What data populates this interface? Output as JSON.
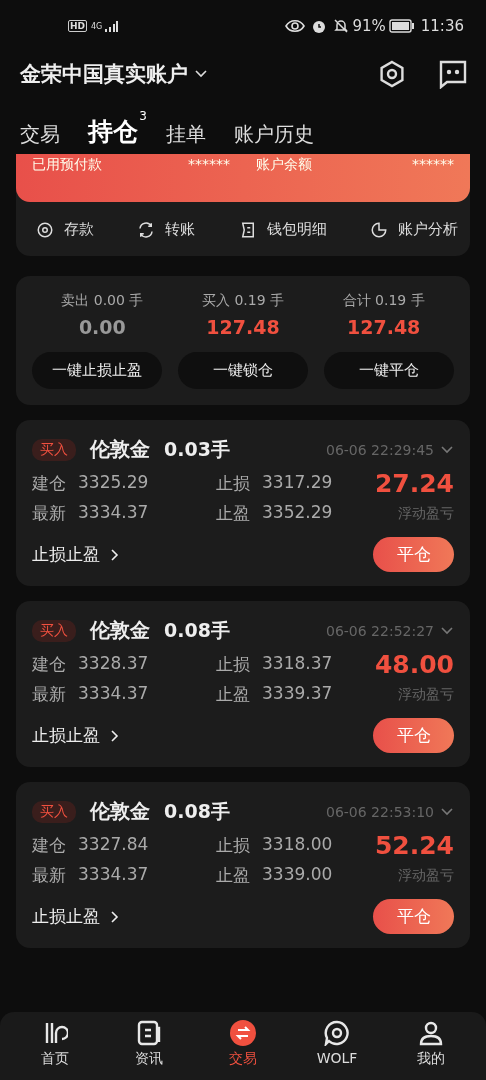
{
  "status_bar": {
    "left": [
      "HD",
      "4G"
    ],
    "battery": "91%",
    "time": "11:36"
  },
  "header": {
    "title": "金荣中国真实账户"
  },
  "tabs": [
    {
      "label": "交易",
      "selected": false
    },
    {
      "label": "持仓",
      "selected": true,
      "count": "3"
    },
    {
      "label": "挂单",
      "selected": false
    },
    {
      "label": "账户历史",
      "selected": false
    }
  ],
  "account_card": {
    "items": [
      {
        "label": "已用预付款",
        "value": "******"
      },
      {
        "label": "账户余额",
        "value": "******"
      }
    ],
    "actions": [
      {
        "label": "存款",
        "kind": "deposit"
      },
      {
        "label": "转账",
        "kind": "transfer"
      },
      {
        "label": "钱包明细",
        "kind": "wallet"
      },
      {
        "label": "账户分析",
        "kind": "analysis"
      }
    ]
  },
  "summary": {
    "columns": [
      {
        "label": "卖出 0.00 手",
        "value": "0.00",
        "positive": false
      },
      {
        "label": "买入 0.19 手",
        "value": "127.48",
        "positive": true
      },
      {
        "label": "合计 0.19 手",
        "value": "127.48",
        "positive": true
      }
    ],
    "buttons": [
      "一键止损止盈",
      "一键锁仓",
      "一键平仓"
    ]
  },
  "positions": [
    {
      "side": "买入",
      "symbol": "伦敦金",
      "lots": "0.03手",
      "time": "06-06 22:29:45",
      "open_label": "建仓",
      "open": "3325.29",
      "sl_label": "止损",
      "sl": "3317.29",
      "last_label": "最新",
      "last": "3334.37",
      "tp_label": "止盈",
      "tp": "3352.29",
      "profit": "27.24",
      "profit_label": "浮动盈亏",
      "link": "止损止盈",
      "close": "平仓"
    },
    {
      "side": "买入",
      "symbol": "伦敦金",
      "lots": "0.08手",
      "time": "06-06 22:52:27",
      "open_label": "建仓",
      "open": "3328.37",
      "sl_label": "止损",
      "sl": "3318.37",
      "last_label": "最新",
      "last": "3334.37",
      "tp_label": "止盈",
      "tp": "3339.37",
      "profit": "48.00",
      "profit_label": "浮动盈亏",
      "link": "止损止盈",
      "close": "平仓"
    },
    {
      "side": "买入",
      "symbol": "伦敦金",
      "lots": "0.08手",
      "time": "06-06 22:53:10",
      "open_label": "建仓",
      "open": "3327.84",
      "sl_label": "止损",
      "sl": "3318.00",
      "last_label": "最新",
      "last": "3334.37",
      "tp_label": "止盈",
      "tp": "3339.00",
      "profit": "52.24",
      "profit_label": "浮动盈亏",
      "link": "止损止盈",
      "close": "平仓"
    }
  ],
  "bottom_nav": [
    {
      "label": "首页",
      "kind": "home",
      "selected": false
    },
    {
      "label": "资讯",
      "kind": "news",
      "selected": false
    },
    {
      "label": "交易",
      "kind": "trade",
      "selected": true
    },
    {
      "label": "WOLF",
      "kind": "wolf",
      "selected": false
    },
    {
      "label": "我的",
      "kind": "me",
      "selected": false
    }
  ]
}
